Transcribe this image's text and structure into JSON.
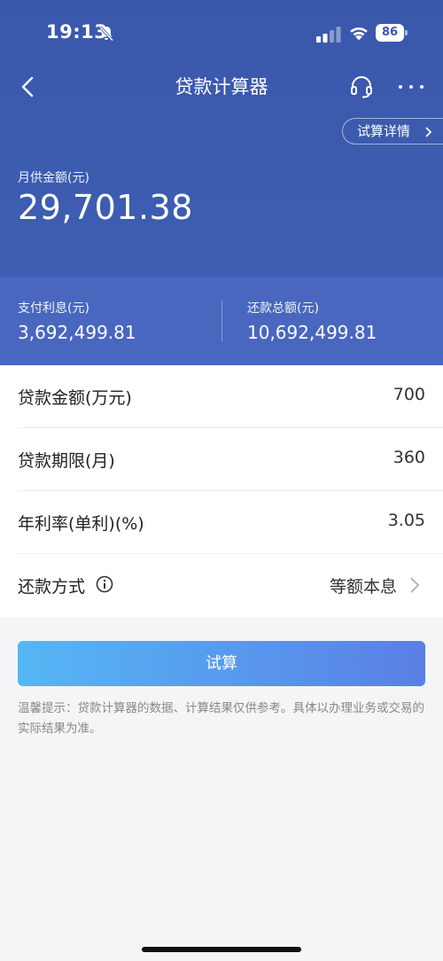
{
  "status_bar": {
    "time": "19:13",
    "battery": "86"
  },
  "nav": {
    "title": "贷款计算器"
  },
  "hero": {
    "detail_button": "试算详情",
    "monthly_label": "月供金额(元)",
    "monthly_value": "29,701.38"
  },
  "summary": {
    "interest_label": "支付利息(元)",
    "interest_value": "3,692,499.81",
    "total_label": "还款总额(元)",
    "total_value": "10,692,499.81"
  },
  "form": {
    "rows": [
      {
        "label": "贷款金额(万元)",
        "value": "700"
      },
      {
        "label": "贷款期限(月)",
        "value": "360"
      },
      {
        "label": "年利率(单利)(%)",
        "value": "3.05"
      },
      {
        "label": "还款方式",
        "value": "等额本息"
      }
    ]
  },
  "calc_button": "试算",
  "tip": "温馨提示：贷款计算器的数据、计算结果仅供参考。具体以办理业务或交易的实际结果为准。",
  "colors": {
    "hero_bg": "#3d5db2",
    "summary_bg": "#4967bf",
    "button_gradient_start": "#55b7f5",
    "button_gradient_end": "#5a7fe6"
  }
}
